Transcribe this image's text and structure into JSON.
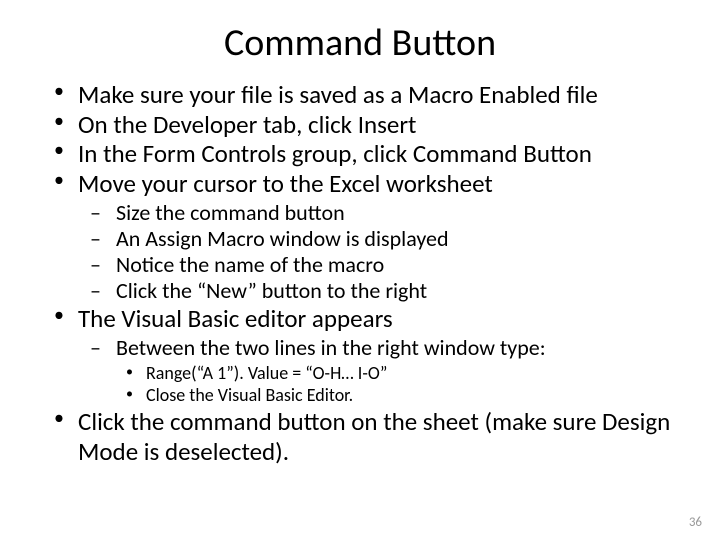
{
  "title": "Command Button",
  "bullets": {
    "b1": "Make sure your file is saved as a Macro Enabled file",
    "b2": "On the Developer tab, click Insert",
    "b3": "In the Form Controls group, click Command Button",
    "b4": "Move your cursor to the Excel worksheet",
    "b4_1": "Size the command button",
    "b4_2": "An Assign Macro window is displayed",
    "b4_3": "Notice the name of the macro",
    "b4_4": "Click the “New” button to the right",
    "b5": "The Visual Basic editor appears",
    "b5_1": "Between the two lines in the right window type:",
    "b5_1_1": "Range(“A 1”). Value = “O-H… I-O”",
    "b5_1_2": "Close the Visual Basic Editor.",
    "b6": "Click the command button on the sheet (make sure Design Mode is deselected)."
  },
  "page_number": "36"
}
